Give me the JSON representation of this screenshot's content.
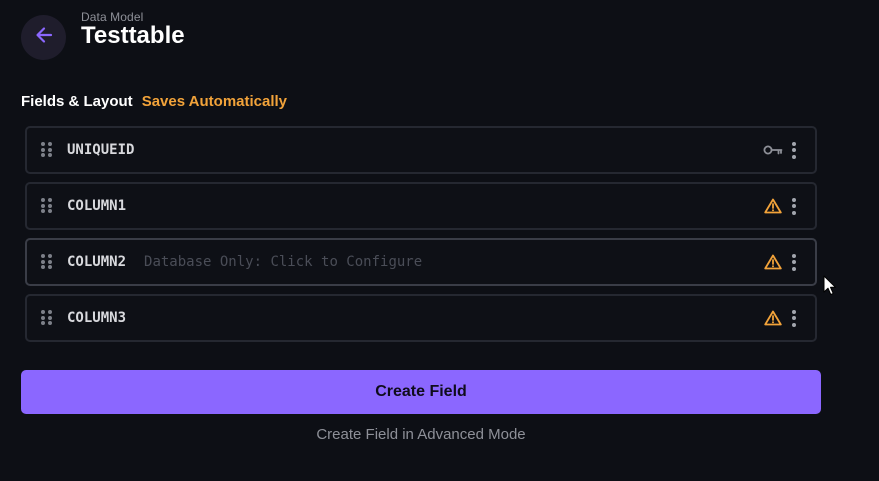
{
  "header": {
    "breadcrumb": "Data Model",
    "title": "Testtable",
    "back_icon": "arrow-left-icon"
  },
  "section": {
    "label": "Fields & Layout",
    "status": "Saves Automatically",
    "status_color": "#f2a33a"
  },
  "fields": [
    {
      "name": "UNIQUEID",
      "hint": "",
      "status_icon": "key-icon"
    },
    {
      "name": "COLUMN1",
      "hint": "",
      "status_icon": "warning-icon"
    },
    {
      "name": "COLUMN2",
      "hint": "Database Only: Click to Configure",
      "status_icon": "warning-icon"
    },
    {
      "name": "COLUMN3",
      "hint": "",
      "status_icon": "warning-icon"
    }
  ],
  "actions": {
    "create_label": "Create Field",
    "advanced_label": "Create Field in Advanced Mode"
  },
  "colors": {
    "accent": "#8b67ff",
    "warning": "#f2a33a",
    "background": "#0d0f15"
  }
}
